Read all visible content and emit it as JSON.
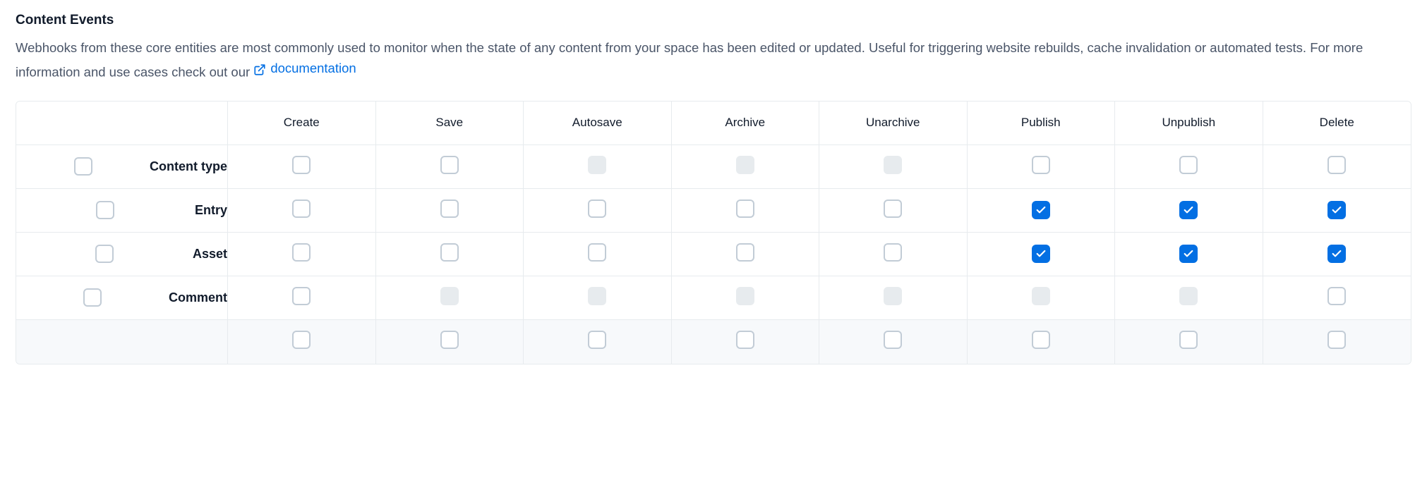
{
  "title": "Content Events",
  "description_part1": "Webhooks from these core entities are most commonly used to monitor when the state of any content from your space has been edited or updated. Useful for triggering website rebuilds, cache invalidation or automated tests. For more information and use cases check out our ",
  "documentation_link_label": "documentation",
  "columns": [
    "Create",
    "Save",
    "Autosave",
    "Archive",
    "Unarchive",
    "Publish",
    "Unpublish",
    "Delete"
  ],
  "rows": [
    {
      "label": "Content type",
      "row_selected": false,
      "cells": [
        {
          "state": "unchecked"
        },
        {
          "state": "unchecked"
        },
        {
          "state": "disabled"
        },
        {
          "state": "disabled"
        },
        {
          "state": "disabled"
        },
        {
          "state": "unchecked"
        },
        {
          "state": "unchecked"
        },
        {
          "state": "unchecked"
        }
      ]
    },
    {
      "label": "Entry",
      "row_selected": false,
      "cells": [
        {
          "state": "unchecked"
        },
        {
          "state": "unchecked"
        },
        {
          "state": "unchecked"
        },
        {
          "state": "unchecked"
        },
        {
          "state": "unchecked"
        },
        {
          "state": "checked"
        },
        {
          "state": "checked"
        },
        {
          "state": "checked"
        }
      ]
    },
    {
      "label": "Asset",
      "row_selected": false,
      "cells": [
        {
          "state": "unchecked"
        },
        {
          "state": "unchecked"
        },
        {
          "state": "unchecked"
        },
        {
          "state": "unchecked"
        },
        {
          "state": "unchecked"
        },
        {
          "state": "checked"
        },
        {
          "state": "checked"
        },
        {
          "state": "checked"
        }
      ]
    },
    {
      "label": "Comment",
      "row_selected": false,
      "cells": [
        {
          "state": "unchecked"
        },
        {
          "state": "disabled"
        },
        {
          "state": "disabled"
        },
        {
          "state": "disabled"
        },
        {
          "state": "disabled"
        },
        {
          "state": "disabled"
        },
        {
          "state": "disabled"
        },
        {
          "state": "unchecked"
        }
      ]
    }
  ],
  "footer_cells": [
    {
      "state": "unchecked"
    },
    {
      "state": "unchecked"
    },
    {
      "state": "unchecked"
    },
    {
      "state": "unchecked"
    },
    {
      "state": "unchecked"
    },
    {
      "state": "unchecked"
    },
    {
      "state": "unchecked"
    },
    {
      "state": "unchecked"
    }
  ]
}
